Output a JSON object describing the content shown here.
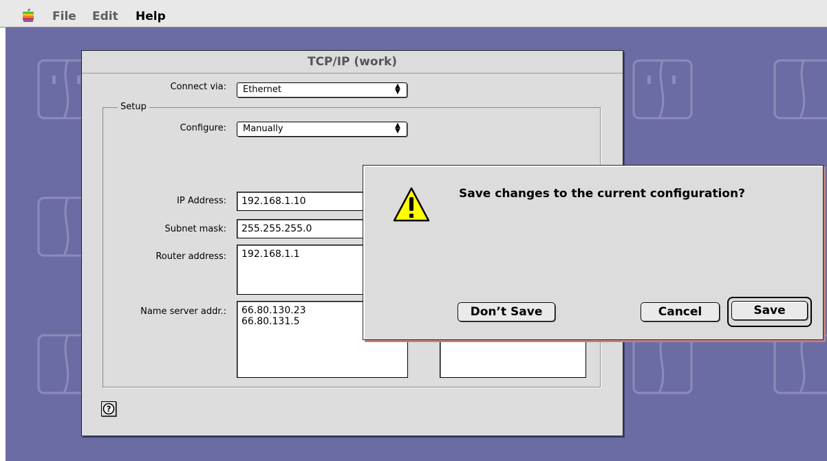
{
  "menubar": {
    "items": [
      "File",
      "Edit",
      "Help"
    ]
  },
  "window": {
    "title": "TCP/IP (work)",
    "connect_via_label": "Connect via:",
    "connect_via_value": "Ethernet",
    "setup_label": "Setup",
    "configure_label": "Configure:",
    "configure_value": "Manually",
    "ip_label": "IP Address:",
    "ip_value": "192.168.1.10",
    "subnet_label": "Subnet mask:",
    "subnet_value": "255.255.255.0",
    "router_label": "Router address:",
    "router_value": "192.168.1.1",
    "nameserver_label": "Name server addr.:",
    "nameserver_value": "66.80.130.23\n66.80.131.5"
  },
  "alert": {
    "message": "Save changes to the current configuration?",
    "dont_save": "Don’t Save",
    "cancel": "Cancel",
    "save": "Save"
  },
  "colors": {
    "desktop": "#6c6ca5",
    "window": "#dddddd",
    "alert_shadow": "#c08080",
    "warning_yellow": "#ffff00"
  },
  "icons": [
    "apple-icon",
    "finder-face-icon",
    "help-icon",
    "warning-icon",
    "popup-arrows-icon"
  ]
}
